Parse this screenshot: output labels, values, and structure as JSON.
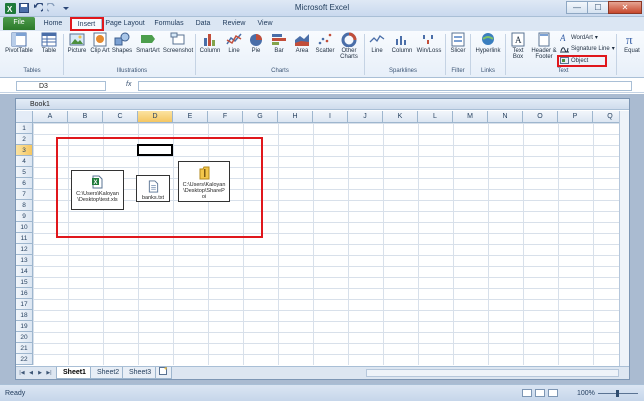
{
  "window": {
    "title": "Microsoft Excel",
    "minimize": "—",
    "maximize": "☐",
    "close": "✕"
  },
  "ribbon_tabs": [
    {
      "label": "File"
    },
    {
      "label": "Home"
    },
    {
      "label": "Insert"
    },
    {
      "label": "Page Layout"
    },
    {
      "label": "Formulas"
    },
    {
      "label": "Data"
    },
    {
      "label": "Review"
    },
    {
      "label": "View"
    }
  ],
  "ribbon": {
    "tables": {
      "group": "Tables",
      "pivottable": "PivotTable",
      "table": "Table"
    },
    "illustrations": {
      "group": "Illustrations",
      "picture": "Picture",
      "clipart": "Clip Art",
      "shapes": "Shapes",
      "smartart": "SmartArt",
      "screenshot": "Screenshot"
    },
    "charts": {
      "group": "Charts",
      "column": "Column",
      "line": "Line",
      "pie": "Pie",
      "bar": "Bar",
      "area": "Area",
      "scatter": "Scatter",
      "other": "Other Charts"
    },
    "sparklines": {
      "group": "Sparklines",
      "line": "Line",
      "column": "Column",
      "winloss": "Win/Loss"
    },
    "filter": {
      "group": "Filter",
      "slicer": "Slicer"
    },
    "links": {
      "group": "Links",
      "hyperlink": "Hyperlink"
    },
    "text": {
      "group": "Text",
      "textbox": "Text Box",
      "header_footer": "Header & Footer",
      "wordart": "WordArt",
      "signature_line": "Signature Line",
      "object": "Object"
    },
    "symbols": {
      "equation": "Equat"
    }
  },
  "formula_bar": {
    "name_box": "D3",
    "fx": "fx",
    "value": ""
  },
  "workbook": {
    "title": "Book1",
    "columns": [
      "A",
      "B",
      "C",
      "D",
      "E",
      "F",
      "G",
      "H",
      "I",
      "J",
      "K",
      "L",
      "M",
      "N",
      "O",
      "P",
      "Q"
    ],
    "rows": [
      "1",
      "2",
      "3",
      "4",
      "5",
      "6",
      "7",
      "8",
      "9",
      "10",
      "11",
      "12",
      "13",
      "14",
      "15",
      "16",
      "17",
      "18",
      "19",
      "20",
      "21",
      "22"
    ],
    "selected_cell": "D3",
    "objects": [
      {
        "caption": "C:\\Users\\Kaloyan\\Desktop\\test.xls",
        "icon": "excel-file-icon"
      },
      {
        "caption": "banks.txt",
        "icon": "text-file-icon"
      },
      {
        "caption": "C:\\Users\\Kaloyan\\Desktop\\SharePoi",
        "icon": "zip-folder-icon"
      }
    ],
    "sheets": [
      "Sheet1",
      "Sheet2",
      "Sheet3"
    ]
  },
  "status": {
    "mode": "Ready",
    "zoom": "100%"
  },
  "colors": {
    "highlight_red": "#e0171c",
    "file_tab": "#2c7a2a",
    "selection": "#f5c661"
  }
}
